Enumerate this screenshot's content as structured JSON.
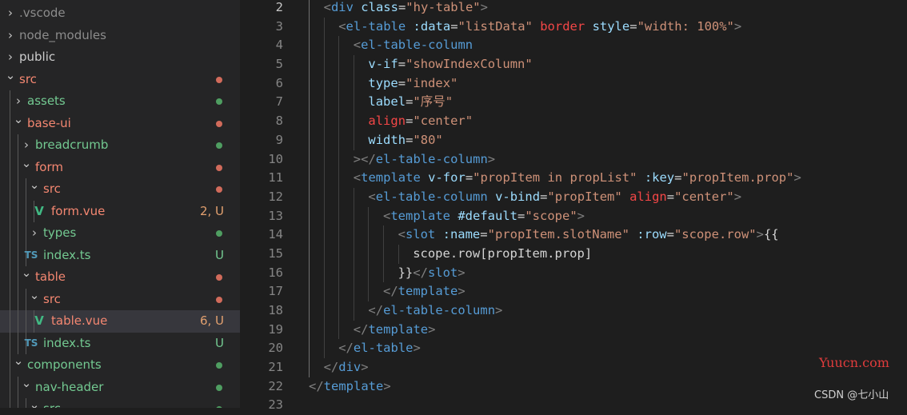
{
  "explorer": {
    "items": [
      {
        "label": ".vscode",
        "type": "folder",
        "expanded": false,
        "depth": 0,
        "color": "#8c8c8c"
      },
      {
        "label": "node_modules",
        "type": "folder",
        "expanded": false,
        "depth": 0,
        "color": "#8c8c8c"
      },
      {
        "label": "public",
        "type": "folder",
        "expanded": false,
        "depth": 0,
        "color": "#cccccc"
      },
      {
        "label": "src",
        "type": "folder",
        "expanded": true,
        "depth": 0,
        "color": "#f48771",
        "dot": "#d16b5b"
      },
      {
        "label": "assets",
        "type": "folder",
        "expanded": false,
        "depth": 1,
        "color": "#73c991",
        "dot": "#4f9e61"
      },
      {
        "label": "base-ui",
        "type": "folder",
        "expanded": true,
        "depth": 1,
        "color": "#f48771",
        "dot": "#d16b5b"
      },
      {
        "label": "breadcrumb",
        "type": "folder",
        "expanded": false,
        "depth": 2,
        "color": "#73c991",
        "dot": "#4f9e61"
      },
      {
        "label": "form",
        "type": "folder",
        "expanded": true,
        "depth": 2,
        "color": "#f48771",
        "dot": "#d16b5b"
      },
      {
        "label": "src",
        "type": "folder",
        "expanded": true,
        "depth": 3,
        "color": "#f48771",
        "dot": "#d16b5b"
      },
      {
        "label": "form.vue",
        "type": "vue",
        "depth": 4,
        "color": "#f48771",
        "badge": "2, U",
        "badge_color": "#e2a06f"
      },
      {
        "label": "types",
        "type": "folder",
        "expanded": false,
        "depth": 3,
        "color": "#73c991",
        "dot": "#4f9e61"
      },
      {
        "label": "index.ts",
        "type": "ts",
        "depth": 3,
        "color": "#73c991",
        "badge": "U",
        "badge_color": "#73c991"
      },
      {
        "label": "table",
        "type": "folder",
        "expanded": true,
        "depth": 2,
        "color": "#f48771",
        "dot": "#d16b5b"
      },
      {
        "label": "src",
        "type": "folder",
        "expanded": true,
        "depth": 3,
        "color": "#f48771",
        "dot": "#d16b5b"
      },
      {
        "label": "table.vue",
        "type": "vue",
        "depth": 4,
        "color": "#f48771",
        "badge": "6, U",
        "badge_color": "#e2a06f",
        "selected": true
      },
      {
        "label": "index.ts",
        "type": "ts",
        "depth": 3,
        "color": "#73c991",
        "badge": "U",
        "badge_color": "#73c991"
      },
      {
        "label": "components",
        "type": "folder",
        "expanded": true,
        "depth": 1,
        "color": "#73c991",
        "dot": "#4f9e61"
      },
      {
        "label": "nav-header",
        "type": "folder",
        "expanded": true,
        "depth": 2,
        "color": "#73c991",
        "dot": "#4f9e61"
      },
      {
        "label": "src",
        "type": "folder",
        "expanded": true,
        "depth": 3,
        "color": "#73c991",
        "dot": "#4f9e61"
      }
    ]
  },
  "editor": {
    "active_line": 2,
    "lines": [
      {
        "num": "2",
        "indent": 1,
        "tokens": [
          [
            "<",
            "#808080"
          ],
          [
            "div",
            "#569cd6"
          ],
          [
            " ",
            ""
          ],
          [
            "class",
            "#9cdcfe"
          ],
          [
            "=",
            "#d4d4d4"
          ],
          [
            "\"hy-table\"",
            "#ce9178"
          ],
          [
            ">",
            "#808080"
          ]
        ]
      },
      {
        "num": "3",
        "indent": 2,
        "tokens": [
          [
            "<",
            "#808080"
          ],
          [
            "el-table",
            "#569cd6"
          ],
          [
            " ",
            ""
          ],
          [
            ":data",
            "#9cdcfe"
          ],
          [
            "=",
            "#d4d4d4"
          ],
          [
            "\"listData\"",
            "#ce9178"
          ],
          [
            " ",
            ""
          ],
          [
            "border",
            "#f44747"
          ],
          [
            " ",
            ""
          ],
          [
            "style",
            "#9cdcfe"
          ],
          [
            "=",
            "#d4d4d4"
          ],
          [
            "\"width: 100%\"",
            "#ce9178"
          ],
          [
            ">",
            "#808080"
          ]
        ]
      },
      {
        "num": "4",
        "indent": 3,
        "tokens": [
          [
            "<",
            "#808080"
          ],
          [
            "el-table-column",
            "#569cd6"
          ]
        ]
      },
      {
        "num": "5",
        "indent": 4,
        "tokens": [
          [
            "v-if",
            "#9cdcfe"
          ],
          [
            "=",
            "#d4d4d4"
          ],
          [
            "\"showIndexColumn\"",
            "#ce9178"
          ]
        ]
      },
      {
        "num": "6",
        "indent": 4,
        "tokens": [
          [
            "type",
            "#9cdcfe"
          ],
          [
            "=",
            "#d4d4d4"
          ],
          [
            "\"index\"",
            "#ce9178"
          ]
        ]
      },
      {
        "num": "7",
        "indent": 4,
        "tokens": [
          [
            "label",
            "#9cdcfe"
          ],
          [
            "=",
            "#d4d4d4"
          ],
          [
            "\"序号\"",
            "#ce9178"
          ]
        ]
      },
      {
        "num": "8",
        "indent": 4,
        "tokens": [
          [
            "align",
            "#f44747"
          ],
          [
            "=",
            "#d4d4d4"
          ],
          [
            "\"center\"",
            "#ce9178"
          ]
        ]
      },
      {
        "num": "9",
        "indent": 4,
        "tokens": [
          [
            "width",
            "#9cdcfe"
          ],
          [
            "=",
            "#d4d4d4"
          ],
          [
            "\"80\"",
            "#ce9178"
          ]
        ]
      },
      {
        "num": "10",
        "indent": 3,
        "tokens": [
          [
            "></",
            "#808080"
          ],
          [
            "el-table-column",
            "#569cd6"
          ],
          [
            ">",
            "#808080"
          ]
        ]
      },
      {
        "num": "11",
        "indent": 3,
        "tokens": [
          [
            "<",
            "#808080"
          ],
          [
            "template",
            "#569cd6"
          ],
          [
            " ",
            ""
          ],
          [
            "v-for",
            "#9cdcfe"
          ],
          [
            "=",
            "#d4d4d4"
          ],
          [
            "\"propItem in propList\"",
            "#ce9178"
          ],
          [
            " ",
            ""
          ],
          [
            ":key",
            "#9cdcfe"
          ],
          [
            "=",
            "#d4d4d4"
          ],
          [
            "\"propItem.prop\"",
            "#ce9178"
          ],
          [
            ">",
            "#808080"
          ]
        ]
      },
      {
        "num": "12",
        "indent": 4,
        "tokens": [
          [
            "<",
            "#808080"
          ],
          [
            "el-table-column",
            "#569cd6"
          ],
          [
            " ",
            ""
          ],
          [
            "v-bind",
            "#9cdcfe"
          ],
          [
            "=",
            "#d4d4d4"
          ],
          [
            "\"propItem\"",
            "#ce9178"
          ],
          [
            " ",
            ""
          ],
          [
            "align",
            "#f44747"
          ],
          [
            "=",
            "#d4d4d4"
          ],
          [
            "\"center\"",
            "#ce9178"
          ],
          [
            ">",
            "#808080"
          ]
        ]
      },
      {
        "num": "13",
        "indent": 5,
        "tokens": [
          [
            "<",
            "#808080"
          ],
          [
            "template",
            "#569cd6"
          ],
          [
            " ",
            ""
          ],
          [
            "#default",
            "#9cdcfe"
          ],
          [
            "=",
            "#d4d4d4"
          ],
          [
            "\"scope\"",
            "#ce9178"
          ],
          [
            ">",
            "#808080"
          ]
        ]
      },
      {
        "num": "14",
        "indent": 6,
        "tokens": [
          [
            "<",
            "#808080"
          ],
          [
            "slot",
            "#569cd6"
          ],
          [
            " ",
            ""
          ],
          [
            ":name",
            "#9cdcfe"
          ],
          [
            "=",
            "#d4d4d4"
          ],
          [
            "\"propItem.slotName\"",
            "#ce9178"
          ],
          [
            " ",
            ""
          ],
          [
            ":row",
            "#9cdcfe"
          ],
          [
            "=",
            "#d4d4d4"
          ],
          [
            "\"scope.row\"",
            "#ce9178"
          ],
          [
            ">",
            "#808080"
          ],
          [
            "{{",
            "#d4d4d4"
          ]
        ]
      },
      {
        "num": "15",
        "indent": 7,
        "tokens": [
          [
            "scope.row[propItem.prop]",
            "#d4d4d4"
          ]
        ]
      },
      {
        "num": "16",
        "indent": 6,
        "tokens": [
          [
            "}}",
            "#d4d4d4"
          ],
          [
            "</",
            "#808080"
          ],
          [
            "slot",
            "#569cd6"
          ],
          [
            ">",
            "#808080"
          ]
        ]
      },
      {
        "num": "17",
        "indent": 5,
        "tokens": [
          [
            "</",
            "#808080"
          ],
          [
            "template",
            "#569cd6"
          ],
          [
            ">",
            "#808080"
          ]
        ]
      },
      {
        "num": "18",
        "indent": 4,
        "tokens": [
          [
            "</",
            "#808080"
          ],
          [
            "el-table-column",
            "#569cd6"
          ],
          [
            ">",
            "#808080"
          ]
        ]
      },
      {
        "num": "19",
        "indent": 3,
        "tokens": [
          [
            "</",
            "#808080"
          ],
          [
            "template",
            "#569cd6"
          ],
          [
            ">",
            "#808080"
          ]
        ]
      },
      {
        "num": "20",
        "indent": 2,
        "tokens": [
          [
            "</",
            "#808080"
          ],
          [
            "el-table",
            "#569cd6"
          ],
          [
            ">",
            "#808080"
          ]
        ]
      },
      {
        "num": "21",
        "indent": 1,
        "tokens": [
          [
            "</",
            "#808080"
          ],
          [
            "div",
            "#569cd6"
          ],
          [
            ">",
            "#808080"
          ]
        ]
      },
      {
        "num": "22",
        "indent": 0,
        "tokens": [
          [
            "</",
            "#808080"
          ],
          [
            "template",
            "#569cd6"
          ],
          [
            ">",
            "#808080"
          ]
        ]
      },
      {
        "num": "23",
        "indent": 0,
        "tokens": []
      }
    ]
  },
  "watermark": {
    "text": "Yuucn.com"
  },
  "credit": {
    "text": "CSDN @七小山"
  }
}
